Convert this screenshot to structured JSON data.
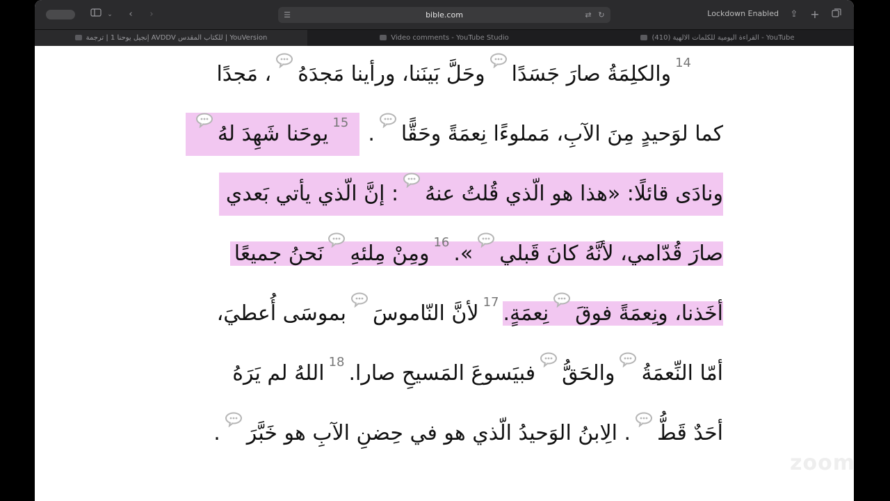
{
  "browser": {
    "url": "bible.com",
    "lockdown_label": "Lockdown Enabled",
    "tabs": [
      {
        "label": "إنجيل يوحنا 1 | ترجمة AVDDV للكتاب المقدس | YouVersion",
        "active": true
      },
      {
        "label": "Video comments - YouTube Studio",
        "active": false
      },
      {
        "label": "(410) القراءة اليومية للكلمات الالهية - YouTube",
        "active": false
      }
    ],
    "icons": [
      "sidebar-icon",
      "chevron-left-icon",
      "chevron-right-icon",
      "translate-icon",
      "reload-icon",
      "share-icon",
      "plus-icon",
      "tabs-overview-icon"
    ]
  },
  "reader": {
    "lines": [
      {
        "v14_num": "14",
        "v14_a": "والكلِمَةُ صارَ جَسَدًا",
        "v14_b": "وحَلَّ بَينَنا، ورأينا مَجدَهُ",
        "v14_c": "، مَجدًا"
      },
      {
        "text_a": "كما لوَحيدٍ مِنَ الآبِ، مَملوءًا نِعمَةً وحَقًّا",
        "text_b": ".",
        "v15_num": "15",
        "v15_a": "يوحَنا شَهِدَ لهُ"
      },
      {
        "text_a": "ونادَى قائلًا: «هذا هو الّذي قُلتُ عنهُ",
        "text_b": ": إنَّ الّذي يأتي بَعدي"
      },
      {
        "text_a": "صارَ قُدّامي، لأنَّهُ كانَ قَبلي",
        "text_b": "».",
        "v16_num": "16",
        "v16_a": "ومِنْ مِلئهِ",
        "v16_b": "نَحنُ جميعًا"
      },
      {
        "text_a": "أخَذنا، ونِعمَةً فوقَ",
        "text_b": "نِعمَةٍ.",
        "v17_num": "17",
        "v17_a": "لأنَّ النّاموسَ",
        "v17_b": "بموسَى أُعطيَ،"
      },
      {
        "text_a": "أمّا النِّعمَةُ",
        "text_b": "والحَقُّ",
        "text_c": "فبيَسوعَ المَسيحِ صارا.",
        "v18_num": "18",
        "v18_a": "اللهُ لم يَرَهُ"
      },
      {
        "text_a": "أحَدٌ قَطُّ",
        "text_b": ". الِابنُ الوَحيدُ الّذي هو في حِضنِ الآبِ هو خَبَّرَ",
        "text_c": "."
      }
    ],
    "note_icon": "comment-bubble-icon",
    "highlight_color": "#f2c7f1"
  },
  "overlay": {
    "watermark": "zoom"
  }
}
